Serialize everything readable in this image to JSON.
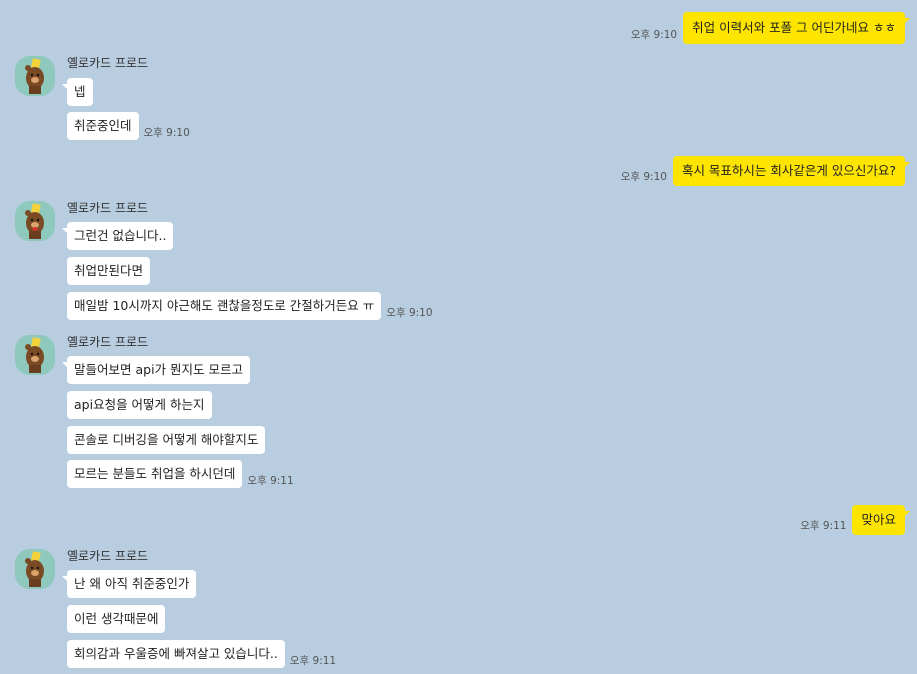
{
  "sender_name": "옐로카드 프로드",
  "colors": {
    "background": "#b8cde0",
    "my_bubble": "#fee500",
    "their_bubble": "#ffffff"
  },
  "messages": {
    "m1": {
      "text": "취업 이력서와 포폴 그 어딘가네요 ㅎㅎ",
      "time": "오후 9:10"
    },
    "g1": {
      "b1": "넵",
      "b2": "취준중인데",
      "time": "오후 9:10"
    },
    "m2": {
      "text": "혹시 목표하시는 회사같은게 있으신가요?",
      "time": "오후 9:10"
    },
    "g2": {
      "b1": "그런건 없습니다..",
      "b2": "취업만된다면",
      "b3": "매일밤 10시까지 야근해도 괜찮을정도로 간절하거든요 ㅠ",
      "time": "오후 9:10"
    },
    "g3": {
      "b1": "말들어보면 api가 뭔지도 모르고",
      "b2": "api요청을 어떻게 하는지",
      "b3": "콘솔로 디버깅을 어떻게 해야할지도",
      "b4": "모르는 분들도 취업을 하시던데",
      "time": "오후 9:11"
    },
    "m3": {
      "text": "맞아요",
      "time": "오후 9:11"
    },
    "g4": {
      "b1": "난 왜 아직 취준중인가",
      "b2": "이런 생각때문에",
      "b3": "회의감과 우울증에 빠져살고 있습니다..",
      "time": "오후 9:11"
    }
  }
}
